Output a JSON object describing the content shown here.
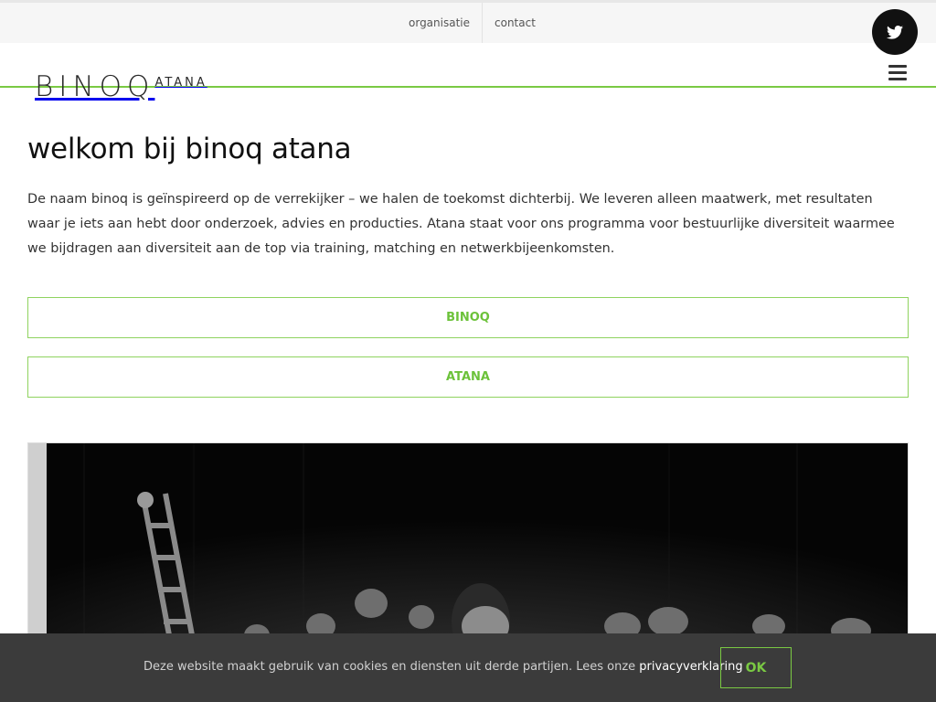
{
  "topnav": {
    "items": [
      "organisatie",
      "contact"
    ]
  },
  "social": {
    "twitter_icon": "twitter-icon"
  },
  "logo": {
    "main": "BINOQ",
    "sub": "ATANA"
  },
  "menu_icon": "hamburger-icon",
  "page": {
    "title": "welkom bij binoq atana",
    "intro": "De naam binoq is geïnspireerd op de verrekijker – we halen de toekomst dichterbij. We leveren alleen maatwerk, met resultaten waar je iets aan hebt door onderzoek, advies en producties. Atana staat voor ons programma voor bestuurlijke diversiteit waarmee we bijdragen aan diversiteit aan de top via training, matching en netwerkbijeenkomsten."
  },
  "buttons": {
    "binoq": "BINOQ",
    "atana": "ATANA"
  },
  "cookie": {
    "text": "Deze website maakt gebruik van cookies en diensten uit derde partijen. Lees onze ",
    "link": "privacyverklaring",
    "ok": "OK"
  },
  "colors": {
    "accent": "#7ac943",
    "cookie_bg": "#3b3b3b",
    "topbar_bg": "#f6f6f6"
  }
}
